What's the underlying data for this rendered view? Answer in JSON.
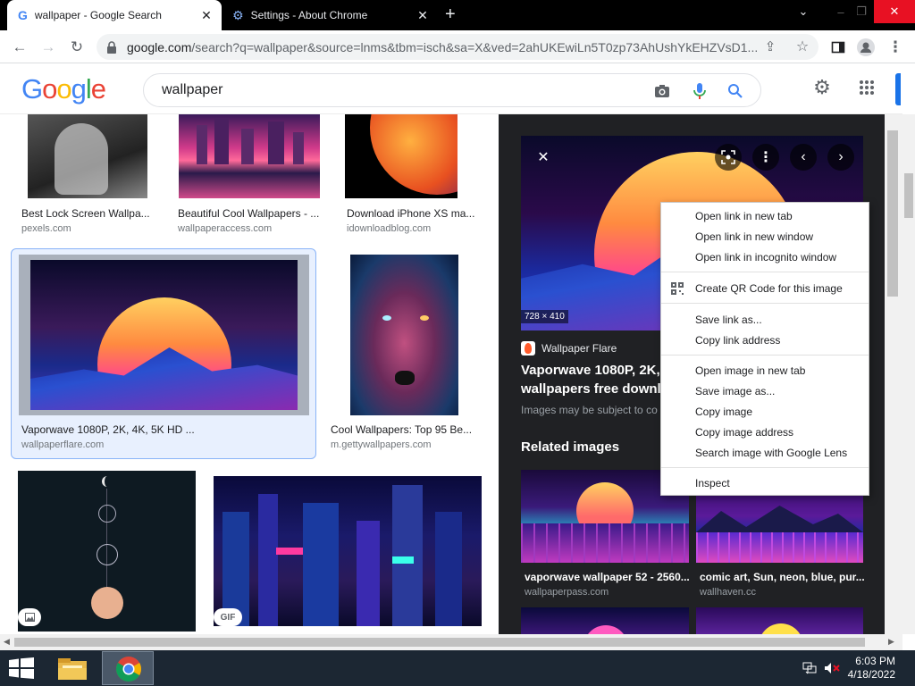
{
  "browser": {
    "tabs": [
      {
        "title": "wallpaper - Google Search",
        "active": true
      },
      {
        "title": "Settings - About Chrome",
        "active": false
      }
    ],
    "url_host": "google.com",
    "url_path": "/search?q=wallpaper&source=lnms&tbm=isch&sa=X&ved=2ahUKEwiLn5T0zp73AhUshYkEHZVsD1..."
  },
  "google": {
    "logo": "Google",
    "query": "wallpaper"
  },
  "results": [
    {
      "title": "Best Lock Screen Wallpa...",
      "source": "pexels.com"
    },
    {
      "title": "Beautiful Cool Wallpapers - ...",
      "source": "wallpaperaccess.com"
    },
    {
      "title": "Download iPhone XS ma...",
      "source": "idownloadblog.com"
    },
    {
      "title": "Vaporwave 1080P, 2K, 4K, 5K HD ...",
      "source": "wallpaperflare.com"
    },
    {
      "title": "Cool Wallpapers: Top 95 Be...",
      "source": "m.gettywallpapers.com"
    },
    {
      "badge": ""
    },
    {
      "badge": "GIF"
    }
  ],
  "preview": {
    "dimensions": "728 × 410",
    "site": "Wallpaper Flare",
    "title_line1": "Vaporwave 1080P, 2K, 4",
    "title_line2": "wallpapers free downlo",
    "note": "Images may be subject to co",
    "related_heading": "Related images",
    "related": [
      {
        "title": "vaporwave wallpaper 52 - 2560...",
        "source": "wallpaperpass.com"
      },
      {
        "title": "comic art, Sun, neon, blue, pur...",
        "source": "wallhaven.cc"
      }
    ]
  },
  "context_menu": {
    "items": [
      "Open link in new tab",
      "Open link in new window",
      "Open link in incognito window",
      "Create QR Code for this image",
      "Save link as...",
      "Copy link address",
      "Open image in new tab",
      "Save image as...",
      "Copy image",
      "Copy image address",
      "Search image with Google Lens",
      "Inspect"
    ]
  },
  "taskbar": {
    "time": "6:03 PM",
    "date": "4/18/2022"
  },
  "colors": {
    "google_blue": "#4285f4",
    "google_red": "#ea4335",
    "google_yellow": "#fbbc05",
    "google_green": "#34a853",
    "panel_bg": "#202124",
    "taskbar_bg": "#1c2733"
  }
}
